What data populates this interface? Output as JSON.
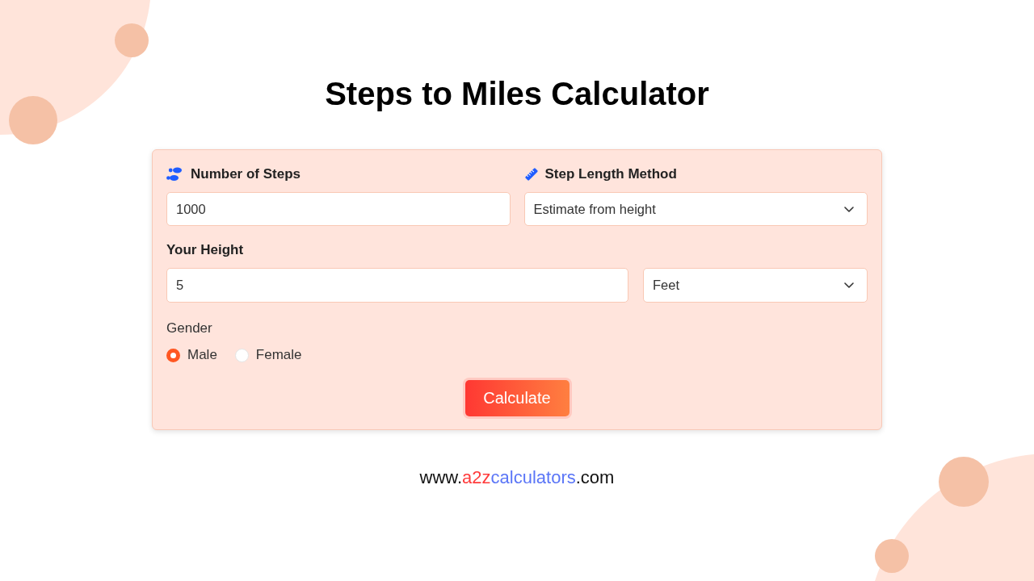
{
  "title": "Steps to Miles Calculator",
  "steps_field": {
    "label": "Number of Steps",
    "value": "1000"
  },
  "method_field": {
    "label": "Step Length Method",
    "value": "Estimate from height"
  },
  "height_field": {
    "label": "Your Height",
    "value": "5",
    "unit": "Feet"
  },
  "gender": {
    "label": "Gender",
    "options": [
      {
        "label": "Male",
        "selected": true
      },
      {
        "label": "Female",
        "selected": false
      }
    ]
  },
  "calculate_button": "Calculate",
  "footer_url": {
    "parts": [
      {
        "text": "www.",
        "color": "#111111"
      },
      {
        "text": "a2z",
        "color": "#ff3b3b"
      },
      {
        "text": "calculators",
        "color": "#5b76f7"
      },
      {
        "text": ".com",
        "color": "#111111"
      }
    ]
  }
}
